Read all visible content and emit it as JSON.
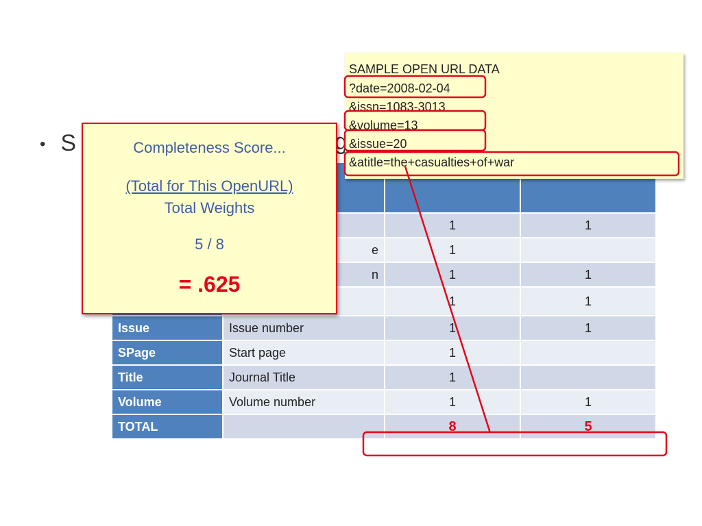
{
  "slide": {
    "bullet_glyph": "•",
    "bullet_visible": "S",
    "bullet_tail_visible": "g"
  },
  "openurl_sample": {
    "title": "SAMPLE OPEN URL DATA",
    "lines": [
      "?date=2008-02-04",
      "&issn=1083-3013",
      "&volume=13",
      "&issue=20",
      "&atitle=the+casualties+of+war"
    ]
  },
  "score_popup": {
    "title": "Completeness Score...",
    "numerator": "(Total for This OpenURL)",
    "denominator": "Total Weights",
    "ratio": "5 / 8",
    "result": "= .625"
  },
  "table": {
    "rows": [
      {
        "key": "",
        "desc": "",
        "weight": "1",
        "present": "1"
      },
      {
        "key": "",
        "desc": "e",
        "weight": "1",
        "present": ""
      },
      {
        "key": "",
        "desc": "n",
        "weight": "1",
        "present": "1"
      },
      {
        "key": "",
        "desc": "",
        "weight": "1",
        "present": "1"
      },
      {
        "key": "Issue",
        "desc": "Issue number",
        "weight": "1",
        "present": "1"
      },
      {
        "key": "SPage",
        "desc": "Start page",
        "weight": "1",
        "present": ""
      },
      {
        "key": "Title",
        "desc": "Journal Title",
        "weight": "1",
        "present": ""
      },
      {
        "key": "Volume",
        "desc": "Volume number",
        "weight": "1",
        "present": "1"
      }
    ],
    "total": {
      "key": "TOTAL",
      "desc": "",
      "weight": "8",
      "present": "5"
    }
  },
  "colors": {
    "table_header": "#4f81bd",
    "row_dark": "#d0d8e8",
    "row_light": "#e9edf4",
    "highlight_red": "#e3061b",
    "note_yellow": "#ffffcc",
    "popup_text": "#3e5da7"
  }
}
